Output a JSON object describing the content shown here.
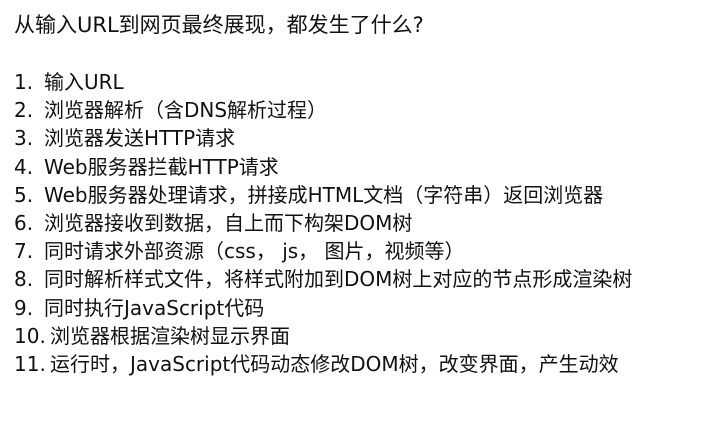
{
  "document": {
    "title": "从输入URL到网页最终展现，都发生了什么?",
    "items": [
      {
        "num": "1.",
        "text": "输入URL"
      },
      {
        "num": "2.",
        "text": "浏览器解析（含DNS解析过程）"
      },
      {
        "num": "3.",
        "text": "浏览器发送HTTP请求"
      },
      {
        "num": "4.",
        "text": "Web服务器拦截HTTP请求"
      },
      {
        "num": "5.",
        "text": "Web服务器处理请求，拼接成HTML文档（字符串）返回浏览器"
      },
      {
        "num": "6.",
        "text": "浏览器接收到数据，自上而下构架DOM树"
      },
      {
        "num": "7.",
        "text": "同时请求外部资源（css， js， 图片，视频等）"
      },
      {
        "num": "8.",
        "text": "同时解析样式文件，将样式附加到DOM树上对应的节点形成渲染树"
      },
      {
        "num": "9.",
        "text": "同时执行JavaScript代码"
      },
      {
        "num": "10.",
        "text": "浏览器根据渲染树显示界面"
      },
      {
        "num": "11.",
        "text": "运行时，JavaScript代码动态修改DOM树，改变界面，产生动效"
      }
    ]
  }
}
